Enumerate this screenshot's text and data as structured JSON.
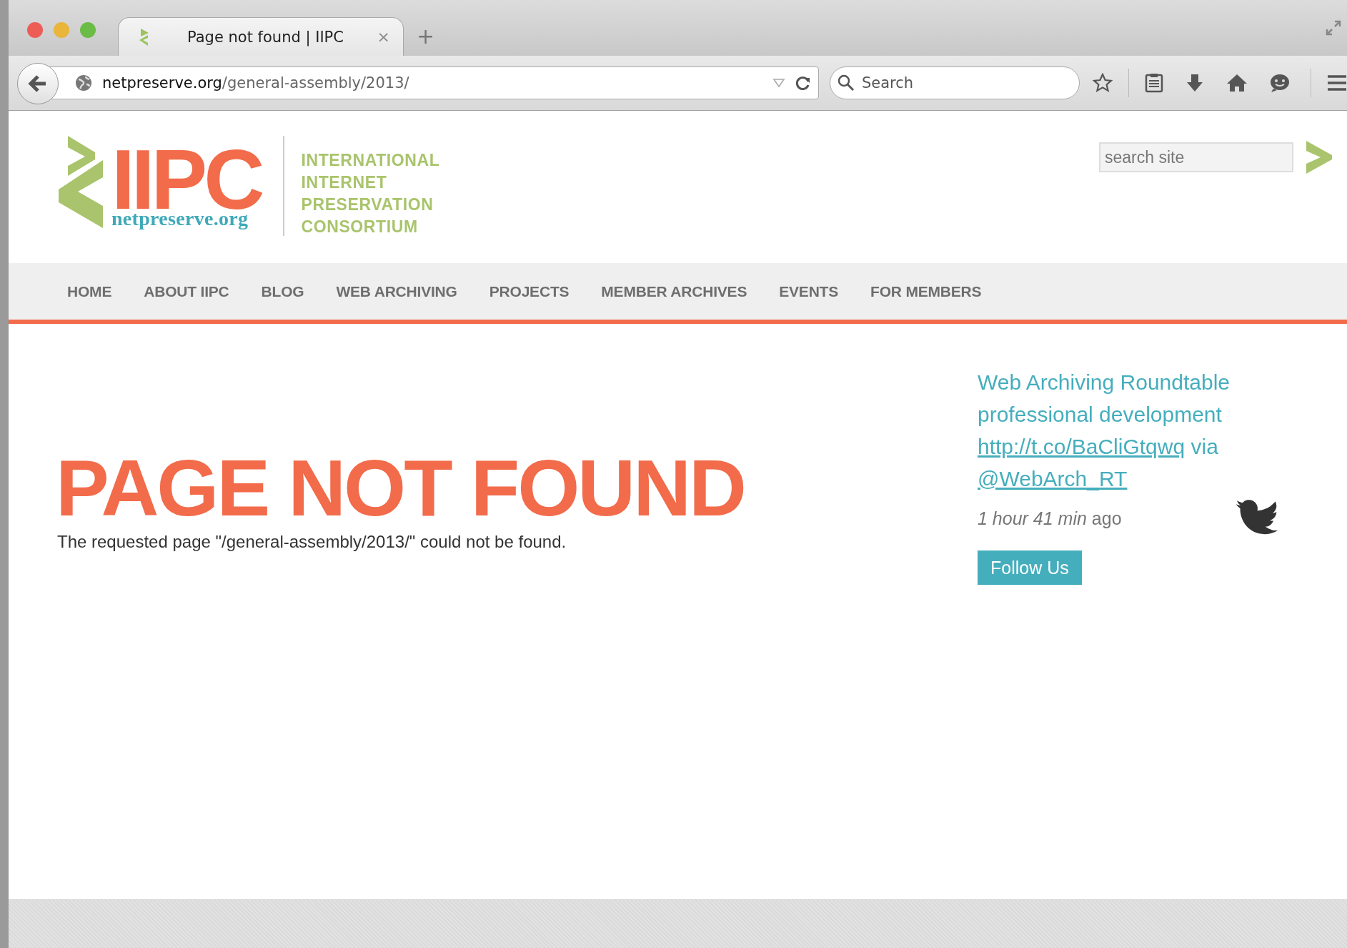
{
  "browser": {
    "tab": {
      "title": "Page not found | IIPC",
      "close": "×"
    },
    "new_tab": "+",
    "address": {
      "domain": "netpreserve.org",
      "path": "/general-assembly/2013/"
    },
    "search": {
      "placeholder": "Search"
    }
  },
  "header": {
    "logo": {
      "letters": "IIPC",
      "domain": "netpreserve.org",
      "tagline": [
        "INTERNATIONAL",
        "INTERNET",
        "PRESERVATION",
        "CONSORTIUM"
      ]
    },
    "search": {
      "placeholder": "search site"
    }
  },
  "nav": [
    {
      "label": "HOME"
    },
    {
      "label": "ABOUT IIPC"
    },
    {
      "label": "BLOG"
    },
    {
      "label": "WEB ARCHIVING"
    },
    {
      "label": "PROJECTS"
    },
    {
      "label": "MEMBER ARCHIVES"
    },
    {
      "label": "EVENTS"
    },
    {
      "label": "FOR MEMBERS"
    }
  ],
  "main": {
    "title": "PAGE NOT FOUND",
    "message": "The requested page \"/general-assembly/2013/\" could not be found."
  },
  "tweet": {
    "text": "Web Archiving Roundtable professional development",
    "link": "http://t.co/BaCliGtqwq",
    "via": "via",
    "handle": "@WebArch_RT",
    "time": "*1 hour 41 min* ago",
    "follow": "Follow Us"
  }
}
